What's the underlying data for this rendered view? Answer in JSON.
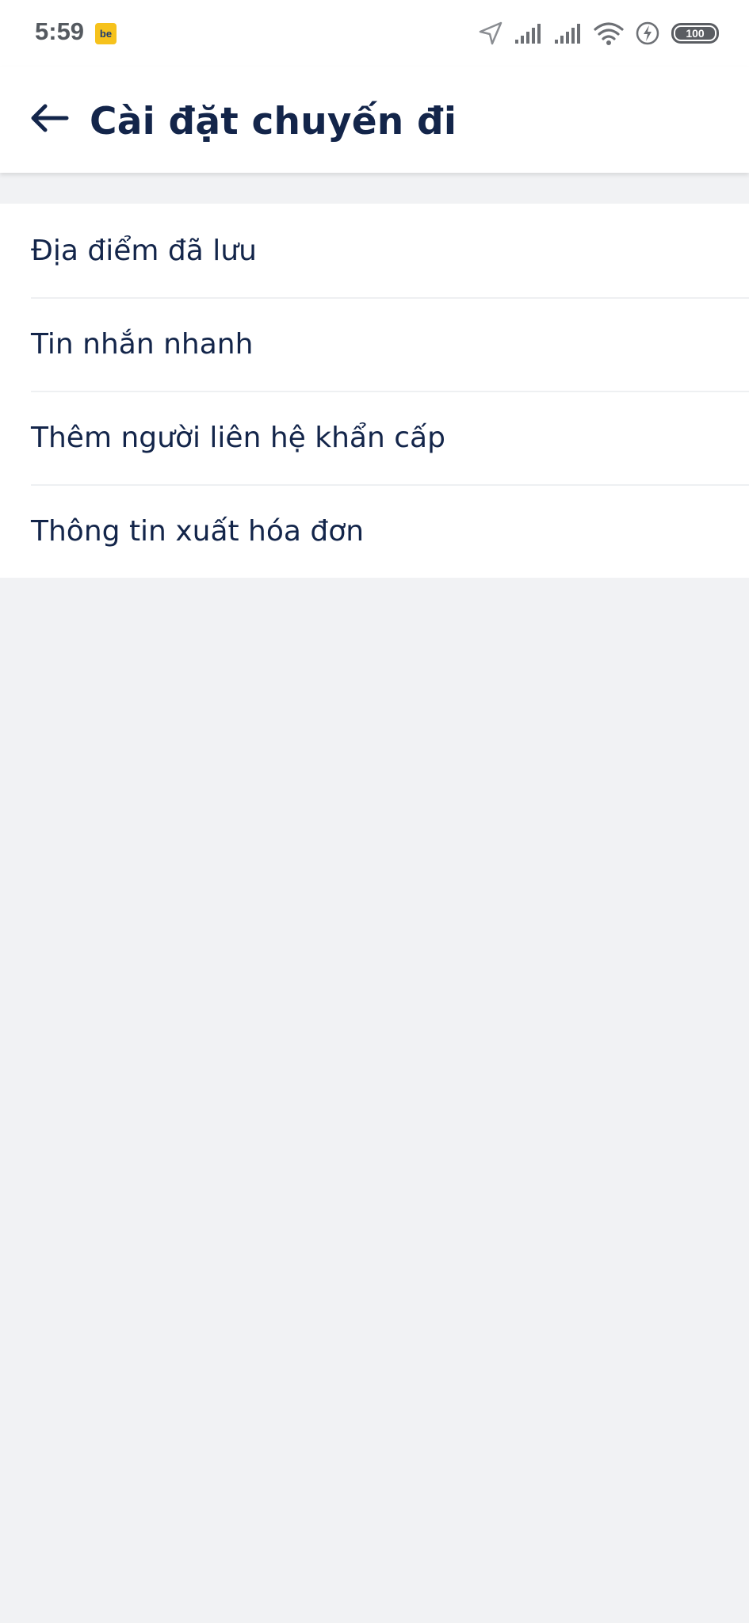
{
  "status_bar": {
    "time": "5:59",
    "app_badge": "be",
    "battery_level": "100",
    "icons": [
      "location-arrow-icon",
      "signal-bars-icon",
      "signal-bars-icon",
      "wifi-icon",
      "charging-icon",
      "battery-icon"
    ]
  },
  "header": {
    "back_icon": "arrow-left-icon",
    "title": "Cài đặt chuyến đi"
  },
  "settings": {
    "items": [
      {
        "label": "Địa điểm đã lưu"
      },
      {
        "label": "Tin nhắn nhanh"
      },
      {
        "label": "Thêm người liên hệ khẩn cấp"
      },
      {
        "label": "Thông tin xuất hóa đơn"
      }
    ]
  },
  "colors": {
    "title_text": "#13254a",
    "background": "#f1f2f4",
    "surface": "#ffffff",
    "badge": "#f6c21c"
  }
}
